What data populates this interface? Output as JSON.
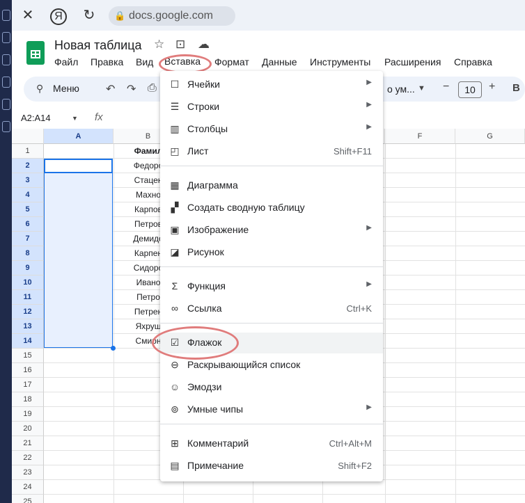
{
  "browser": {
    "url": "docs.google.com"
  },
  "doc": {
    "title": "Новая таблица"
  },
  "menubar": {
    "file": "Файл",
    "edit": "Правка",
    "view": "Вид",
    "insert": "Вставка",
    "format": "Формат",
    "data": "Данные",
    "tools": "Инструменты",
    "extensions": "Расширения",
    "help": "Справка"
  },
  "toolbar": {
    "search": "Меню",
    "font": "о ум...",
    "font_size": "10",
    "bold": "B"
  },
  "formula": {
    "namebox": "A2:A14",
    "fx": "fx"
  },
  "grid": {
    "columns": [
      "A",
      "B",
      "F",
      "G"
    ],
    "rows": [
      "1",
      "2",
      "3",
      "4",
      "5",
      "6",
      "7",
      "8",
      "9",
      "10",
      "11",
      "12",
      "13",
      "14",
      "15",
      "16",
      "17",
      "18",
      "19",
      "20",
      "21",
      "22",
      "23",
      "24",
      "25"
    ],
    "colB": [
      "Фамил",
      "Федоро",
      "Стацен",
      "Махно",
      "Карпов",
      "Петров",
      "Демидо",
      "Карпен",
      "Сидоро",
      "Ивано",
      "Петро",
      "Петрен",
      "Яхруш",
      "Смирн"
    ]
  },
  "insert_menu": {
    "items": [
      {
        "icon": "cells-icon",
        "glyph": "☐",
        "label": "Ячейки",
        "submenu": true
      },
      {
        "icon": "rows-icon",
        "glyph": "☰",
        "label": "Строки",
        "submenu": true
      },
      {
        "icon": "columns-icon",
        "glyph": "▥",
        "label": "Столбцы",
        "submenu": true
      },
      {
        "icon": "sheet-icon",
        "glyph": "◰",
        "label": "Лист",
        "shortcut": "Shift+F11"
      },
      {
        "icon": "chart-icon",
        "glyph": "▦",
        "label": "Диаграмма"
      },
      {
        "icon": "pivot-table-icon",
        "glyph": "▞",
        "label": "Создать сводную таблицу"
      },
      {
        "icon": "image-icon",
        "glyph": "▣",
        "label": "Изображение",
        "submenu": true
      },
      {
        "icon": "drawing-icon",
        "glyph": "◪",
        "label": "Рисунок"
      },
      {
        "icon": "function-icon",
        "glyph": "Σ",
        "label": "Функция",
        "submenu": true
      },
      {
        "icon": "link-icon",
        "glyph": "∞",
        "label": "Ссылка",
        "shortcut": "Ctrl+K"
      },
      {
        "icon": "checkbox-icon",
        "glyph": "☑",
        "label": "Флажок"
      },
      {
        "icon": "dropdown-icon",
        "glyph": "⊖",
        "label": "Раскрывающийся список"
      },
      {
        "icon": "emoji-icon",
        "glyph": "☺",
        "label": "Эмодзи"
      },
      {
        "icon": "smart-chips-icon",
        "glyph": "⊚",
        "label": "Умные чипы",
        "submenu": true
      },
      {
        "icon": "comment-icon",
        "glyph": "⊞",
        "label": "Комментарий",
        "shortcut": "Ctrl+Alt+M"
      },
      {
        "icon": "note-icon",
        "glyph": "▤",
        "label": "Примечание",
        "shortcut": "Shift+F2"
      }
    ]
  },
  "colors": {
    "accent_select": "#d3e3fd",
    "annotation": "#e07c7c",
    "sheets_green": "#0f9d58"
  }
}
